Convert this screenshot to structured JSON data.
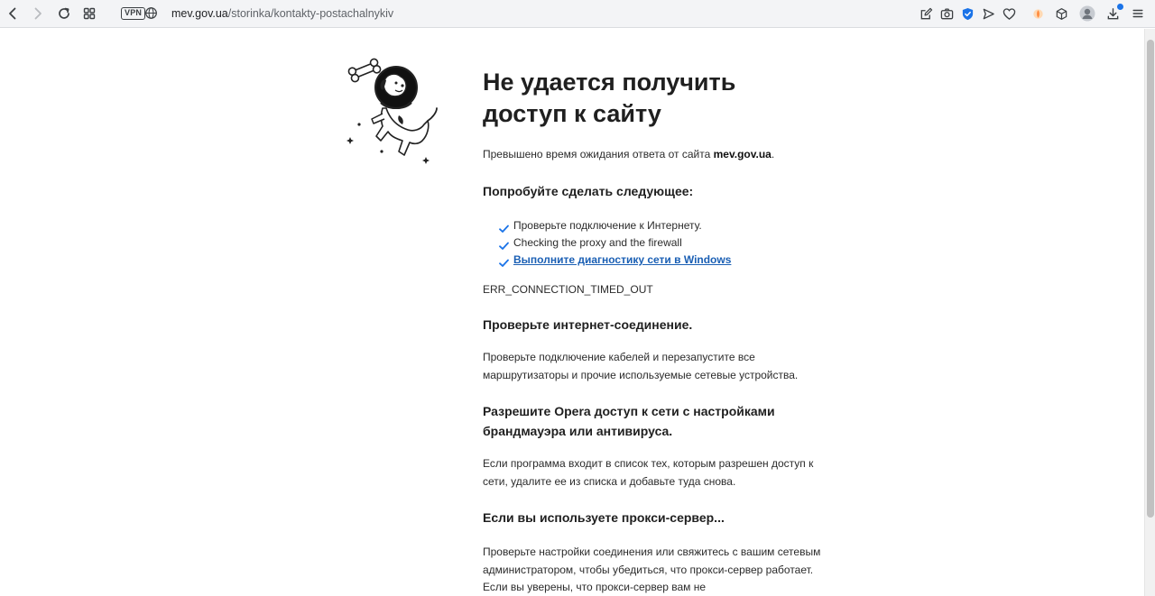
{
  "browser": {
    "vpn_label": "VPN",
    "url_host": "mev.gov.ua",
    "url_path": "/storinka/kontakty-postachalnykiv",
    "icons": [
      "back-icon",
      "forward-icon",
      "reload-icon",
      "tabs-grid-icon",
      "vpn-badge",
      "globe-icon",
      "edit-icon",
      "camera-icon",
      "shield-icon",
      "send-icon",
      "heart-icon",
      "extension-icon",
      "cube-icon",
      "avatar-icon",
      "download-icon",
      "menu-icon"
    ],
    "accent": "#1a73e8"
  },
  "page": {
    "title": "Не удается получить доступ к сайту",
    "timeout_prefix": "Превышено время ожидания ответа от сайта ",
    "timeout_host": "mev.gov.ua",
    "timeout_suffix": ".",
    "try_heading": "Попробуйте сделать следующее:",
    "suggestions": [
      "Проверьте подключение к Интернету.",
      "Checking the proxy and the firewall",
      "Выполните диагностику сети в Windows"
    ],
    "error_code": "ERR_CONNECTION_TIMED_OUT",
    "sections": [
      {
        "heading": "Проверьте интернет-соединение.",
        "text": "Проверьте подключение кабелей и перезапустите все маршрутизаторы и прочие используемые сетевые устройства."
      },
      {
        "heading": "Разрешите Opera доступ к сети с настройками брандмауэра или антивируса.",
        "text": "Если программа входит в список тех, которым разрешен доступ к сети, удалите ее из списка и добавьте туда снова."
      },
      {
        "heading": "Если вы используете прокси-сервер...",
        "text": "Проверьте настройки соединения или свяжитесь с вашим сетевым администратором, чтобы убедиться, что прокси-сервер работает. Если вы уверены, что прокси-сервер вам не"
      }
    ],
    "check_color": "#1a73e8",
    "link_color": "#1a5fb4"
  }
}
